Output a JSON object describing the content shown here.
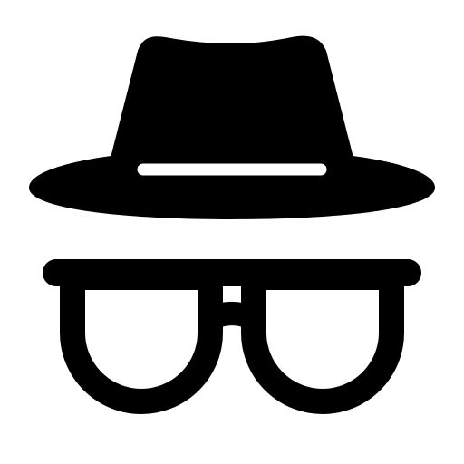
{
  "icon": {
    "name": "incognito-icon",
    "parts": [
      "hat",
      "hat-band",
      "glasses"
    ],
    "colors": {
      "foreground": "#000000",
      "background": "#ffffff"
    }
  }
}
